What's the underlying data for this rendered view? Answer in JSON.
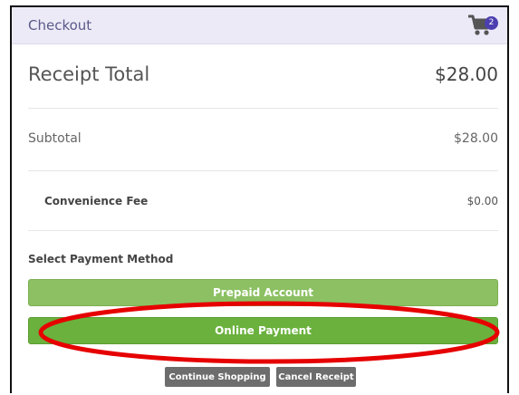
{
  "header": {
    "title": "Checkout",
    "cart_count": "2",
    "cart_icon": "shopping-cart-icon"
  },
  "receipt": {
    "label": "Receipt Total",
    "value": "$28.00"
  },
  "subtotal": {
    "label": "Subtotal",
    "value": "$28.00"
  },
  "fee": {
    "label": "Convenience Fee",
    "value": "$0.00"
  },
  "payment": {
    "label": "Select Payment Method",
    "prepaid_label": "Prepaid Account",
    "online_label": "Online Payment"
  },
  "actions": {
    "continue_label": "Continue Shopping",
    "cancel_label": "Cancel Receipt"
  },
  "colors": {
    "header_bg": "#eceaf7",
    "badge": "#4b3fb0",
    "prepaid_button": "#8cc063",
    "online_button": "#6ab13d",
    "secondary_button": "#6d6d6d",
    "highlight_ring": "#e60000"
  }
}
